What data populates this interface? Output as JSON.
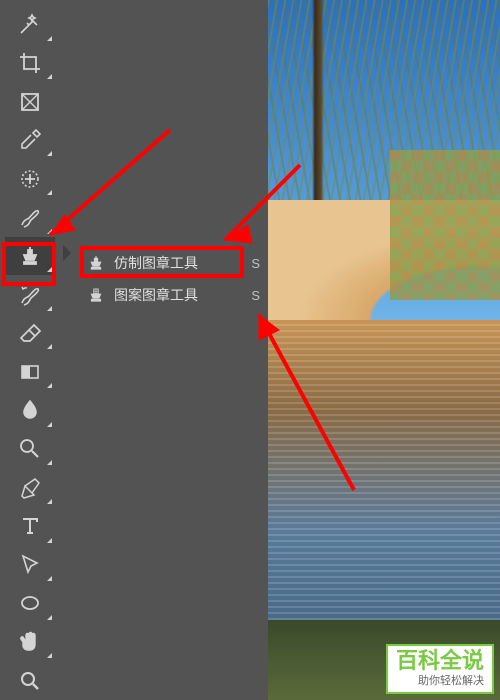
{
  "toolbar": {
    "tools": [
      {
        "name": "magic-wand-icon"
      },
      {
        "name": "crop-icon"
      },
      {
        "name": "frame-icon"
      },
      {
        "name": "eyedropper-icon"
      },
      {
        "name": "healing-brush-icon"
      },
      {
        "name": "brush-icon"
      },
      {
        "name": "clone-stamp-icon",
        "active": true
      },
      {
        "name": "history-brush-icon"
      },
      {
        "name": "eraser-icon"
      },
      {
        "name": "gradient-icon"
      },
      {
        "name": "blur-icon"
      },
      {
        "name": "dodge-icon"
      },
      {
        "name": "pen-icon"
      },
      {
        "name": "type-icon"
      },
      {
        "name": "path-selection-icon"
      },
      {
        "name": "ellipse-icon"
      },
      {
        "name": "hand-icon"
      },
      {
        "name": "zoom-icon"
      }
    ]
  },
  "flyout": {
    "items": [
      {
        "icon": "clone-stamp-icon",
        "label": "仿制图章工具",
        "shortcut": "S"
      },
      {
        "icon": "pattern-stamp-icon",
        "label": "图案图章工具",
        "shortcut": "S"
      }
    ]
  },
  "watermark": {
    "main": "百科全说",
    "sub": "助你轻松解决"
  },
  "colors": {
    "toolbar_bg": "#535353",
    "highlight": "#ff0000",
    "accent_green": "#7ac943"
  }
}
